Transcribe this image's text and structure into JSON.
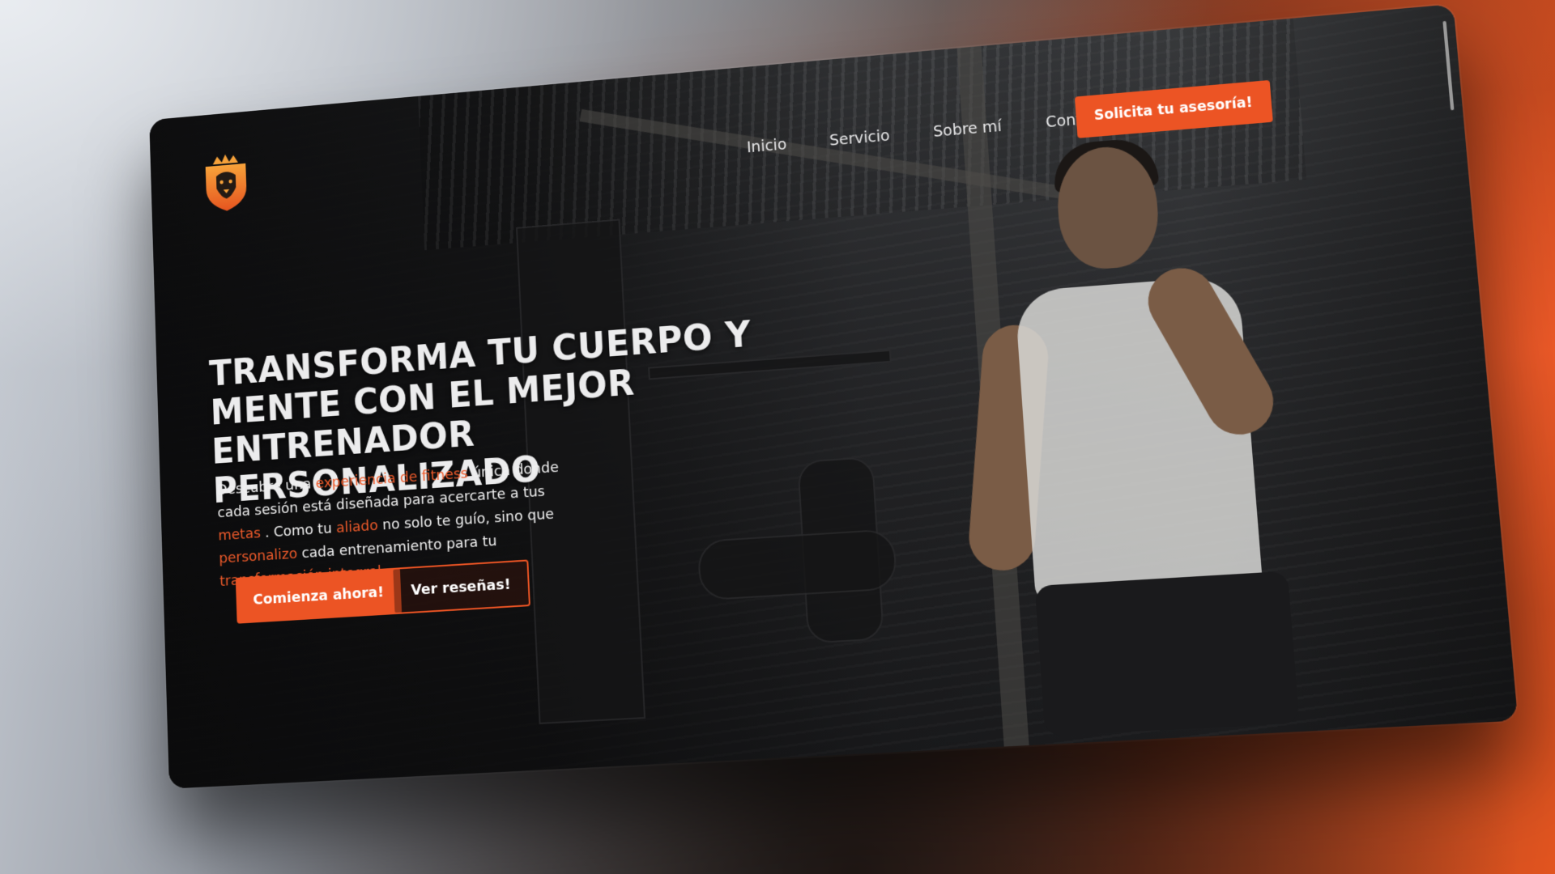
{
  "brand": {
    "logo_icon": "crowned-lion-shield-icon",
    "accent": "#ec5424",
    "logo_gradient": [
      "#f7a23a",
      "#e5541f"
    ]
  },
  "nav": {
    "links": [
      "Inicio",
      "Servicio",
      "Sobre mí",
      "Contacto"
    ],
    "cta_label": "Solicita tu asesoría!"
  },
  "hero": {
    "headline": "TRANSFORMA TU CUERPO Y MENTE CON EL MEJOR ENTRENADOR PERSONALIZADO",
    "description": {
      "p1": "Descubre una ",
      "h1": "experiencia de fitness",
      "p2": " única donde cada sesión está diseñada para acercarte a tus ",
      "h2": "metas",
      "p3": " . Como tu ",
      "h3": "aliado",
      "p4": " no solo te guío, sino que ",
      "h4": "personalizo",
      "p5": " cada entrenamiento para tu ",
      "h5": "transformación integral"
    },
    "primary_button": "Comienza ahora!",
    "secondary_button": "Ver reseñas!"
  }
}
